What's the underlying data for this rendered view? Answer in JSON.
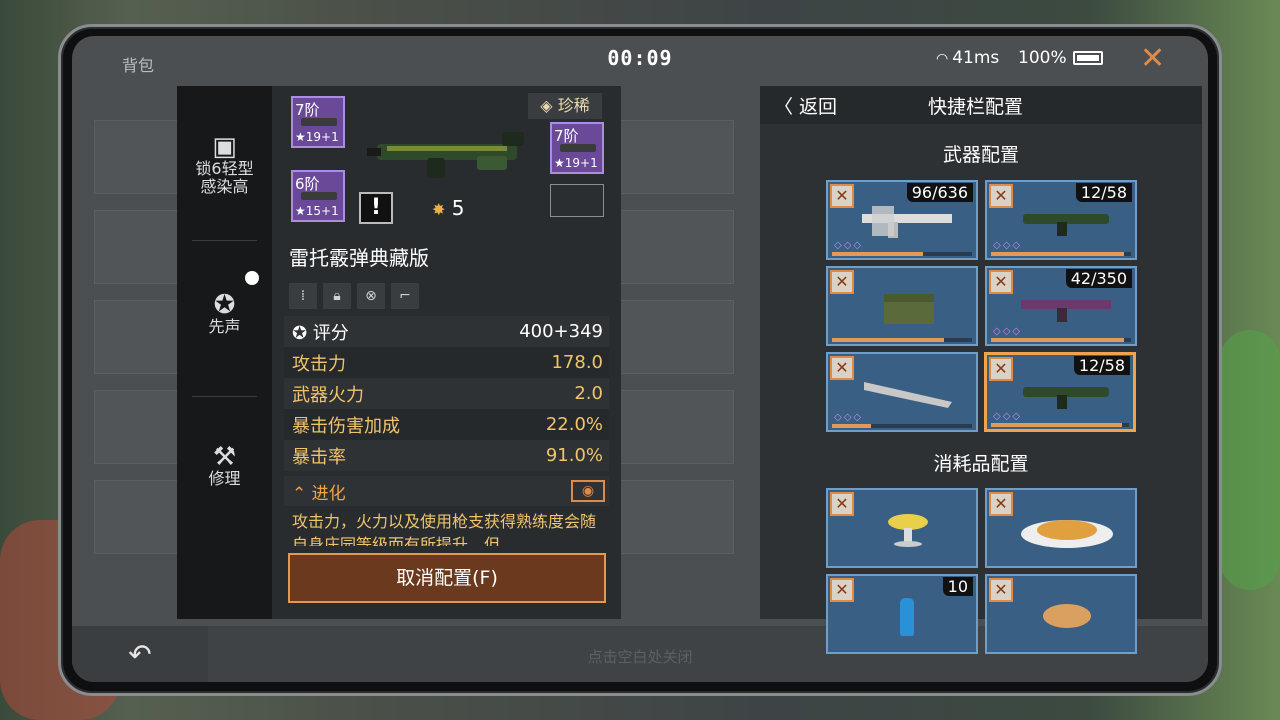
{
  "status": {
    "bag_label": "背包",
    "timer": "00:09",
    "ping": "41ms",
    "battery": "100%",
    "close_icon": "close-x"
  },
  "side_menu": {
    "items": [
      {
        "label": "锁6轻型\n感染高",
        "icon": "warning-box-icon"
      },
      {
        "label": "先声",
        "icon": "gear-star-icon"
      },
      {
        "label": "修理",
        "icon": "hammer-icon"
      }
    ]
  },
  "detail": {
    "rarity": "珍稀",
    "badges": [
      {
        "level": "7阶",
        "stars": "★19+1"
      },
      {
        "level": "6阶",
        "stars": "★15+1"
      },
      {
        "level": "7阶",
        "stars": "★19+1"
      }
    ],
    "warn_mark": "!",
    "star_count": "5",
    "weapon_name": "雷托霰弹典藏版",
    "stats": [
      {
        "key": "评分",
        "value": "400+349"
      },
      {
        "key": "攻击力",
        "value": "178.0"
      },
      {
        "key": "武器火力",
        "value": "2.0"
      },
      {
        "key": "暴击伤害加成",
        "value": "22.0%"
      },
      {
        "key": "暴击率",
        "value": "91.0%"
      }
    ],
    "evolve_label": "进化",
    "description": "攻击力，火力以及使用枪支获得熟练度会随自身庄园等级而有所提升，但",
    "cancel_button": "取消配置(F)"
  },
  "quickbar": {
    "back_label": "返回",
    "title": "快捷栏配置",
    "weapon_section": "武器配置",
    "consumable_section": "消耗品配置",
    "weapons": [
      {
        "ammo": "96/636",
        "bar": 0.65,
        "has_dia": true
      },
      {
        "ammo": "12/58",
        "bar": 0.95,
        "has_dia": true
      },
      {
        "ammo": "",
        "bar": 0.8,
        "has_dia": false
      },
      {
        "ammo": "42/350",
        "bar": 0.95,
        "has_dia": true
      },
      {
        "ammo": "",
        "bar": 0.28,
        "has_dia": true
      },
      {
        "ammo": "12/58",
        "bar": 0.95,
        "has_dia": true,
        "selected": true
      }
    ],
    "consumables": [
      {
        "count": ""
      },
      {
        "count": ""
      },
      {
        "count": "10"
      },
      {
        "count": ""
      }
    ]
  },
  "bottom": {
    "hint": "点击空白处关闭"
  }
}
